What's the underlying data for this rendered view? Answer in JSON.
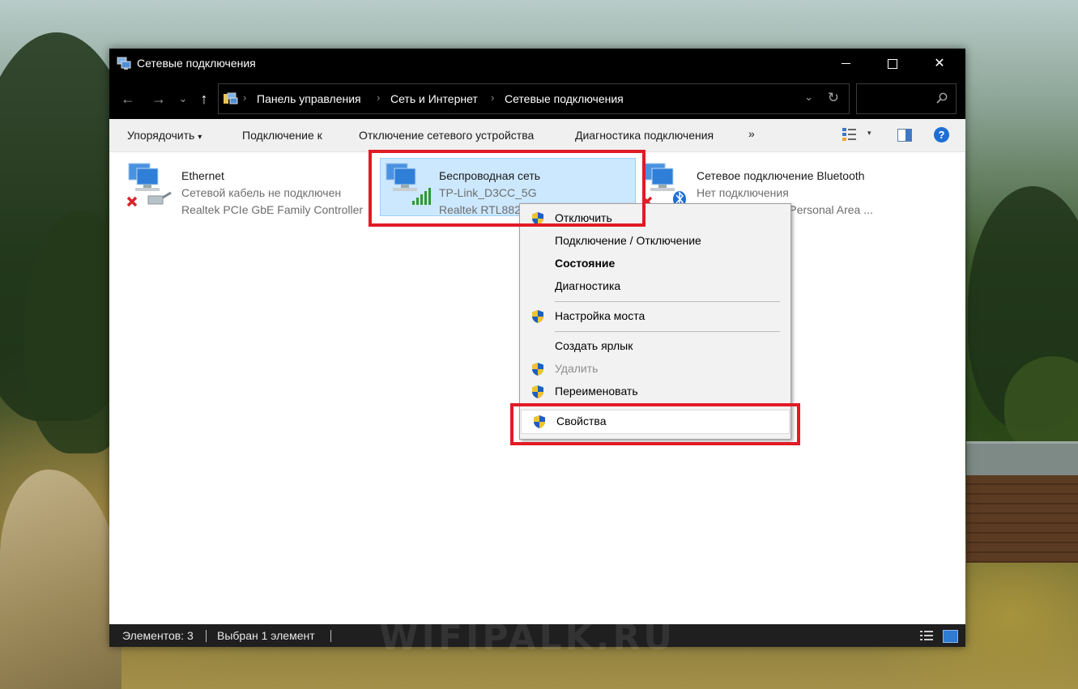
{
  "window": {
    "title": "Сетевые подключения",
    "controls": {
      "minimize": "—",
      "maximize": "",
      "close": "✕"
    }
  },
  "addressbar": {
    "nav": {
      "back": "←",
      "forward": "→",
      "recent": "⌄",
      "up": "↑"
    },
    "breadcrumb": [
      "Панель управления",
      "Сеть и Интернет",
      "Сетевые подключения"
    ],
    "separator": "›",
    "dropdown": "⌄",
    "refresh": "↻",
    "search_placeholder": ""
  },
  "toolbar": {
    "organize": "Упорядочить",
    "organize_caret": "▾",
    "connect_to": "Подключение к",
    "disable_device": "Отключение сетевого устройства",
    "diagnose": "Диагностика подключения",
    "more": "»",
    "view_caret": "▾",
    "help": "?"
  },
  "connections": [
    {
      "name": "Ethernet",
      "status": "Сетевой кабель не подключен",
      "adapter": "Realtek PCIe GbE Family Controller",
      "icon": "ethernet-disconnected-icon"
    },
    {
      "name": "Беспроводная сеть",
      "status": "TP-Link_D3CC_5G",
      "adapter": "Realtek RTL8822CE 802.11ac PCIe",
      "icon": "wifi-connected-icon",
      "selected": true
    },
    {
      "name": "Сетевое подключение Bluetooth",
      "status": "Нет подключения",
      "adapter": "Bluetooth Device (Personal Area ...",
      "icon": "bluetooth-network-icon"
    }
  ],
  "context_menu": {
    "disable": "Отключить",
    "connect_disconnect": "Подключение / Отключение",
    "status": "Состояние",
    "diagnose": "Диагностика",
    "bridge": "Настройка моста",
    "shortcut": "Создать ярлык",
    "delete": "Удалить",
    "rename": "Переименовать",
    "properties": "Свойства"
  },
  "statusbar": {
    "items_count": "Элементов: 3",
    "selected": "Выбран 1 элемент"
  },
  "watermark": "WIFIPALK.RU",
  "colors": {
    "highlight": "#e11b25",
    "selection": "#cce8ff",
    "help_blue": "#1e6fd4"
  }
}
